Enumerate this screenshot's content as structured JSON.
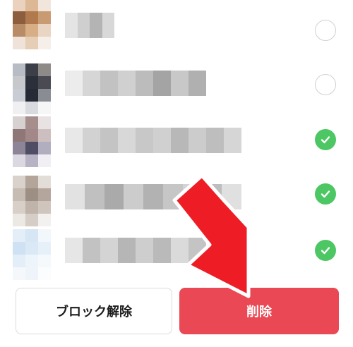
{
  "contacts": [
    {
      "selected": false
    },
    {
      "selected": false
    },
    {
      "selected": true
    },
    {
      "selected": true
    },
    {
      "selected": true
    }
  ],
  "footer": {
    "unblock_label": "ブロック解除",
    "delete_label": "削除"
  },
  "colors": {
    "check_on": "#4cc764",
    "delete_button": "#e94854",
    "annotation_arrow": "#ee1c25"
  },
  "icons": {
    "check": "check-icon",
    "arrow": "arrow-down-right-icon"
  }
}
